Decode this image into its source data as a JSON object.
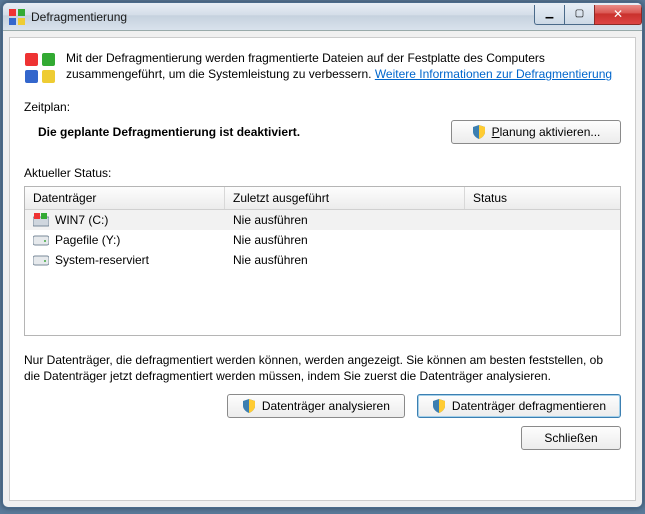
{
  "window": {
    "title": "Defragmentierung"
  },
  "intro": {
    "text": "Mit der Defragmentierung werden fragmentierte Dateien auf der Festplatte des Computers zusammengeführt, um die Systemleistung zu verbessern. ",
    "link": "Weitere Informationen zur Defragmentierung"
  },
  "schedule": {
    "label": "Zeitplan:",
    "status": "Die geplante Defragmentierung ist deaktiviert.",
    "button": "Planung aktivieren..."
  },
  "status": {
    "label": "Aktueller Status:",
    "columns": {
      "drive": "Datenträger",
      "last": "Zuletzt ausgeführt",
      "status": "Status"
    },
    "rows": [
      {
        "name": "WIN7 (C:)",
        "last": "Nie ausführen",
        "status": "",
        "icon": "win"
      },
      {
        "name": "Pagefile (Y:)",
        "last": "Nie ausführen",
        "status": "",
        "icon": "hdd"
      },
      {
        "name": "System-reserviert",
        "last": "Nie ausführen",
        "status": "",
        "icon": "hdd"
      }
    ]
  },
  "hint": "Nur Datenträger, die defragmentiert werden können, werden angezeigt. Sie können am besten feststellen, ob die Datenträger jetzt defragmentiert werden müssen, indem Sie zuerst die Datenträger analysieren.",
  "buttons": {
    "analyze": "Datenträger analysieren",
    "defrag": "Datenträger defragmentieren",
    "close": "Schließen"
  }
}
